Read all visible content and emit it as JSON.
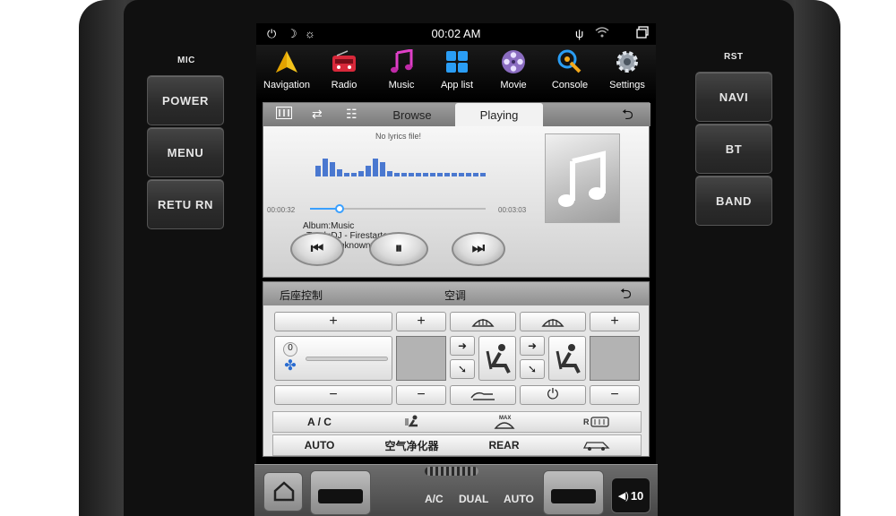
{
  "hardware": {
    "mic_label": "MIC",
    "rst_label": "RST",
    "left_buttons": [
      "POWER",
      "MENU",
      "RETU RN"
    ],
    "right_buttons": [
      "NAVI",
      "BT",
      "BAND"
    ]
  },
  "statusbar": {
    "time": "00:02 AM",
    "icons": [
      "power-icon",
      "night-mode-icon",
      "brightness-icon",
      "usb-icon",
      "wifi-icon",
      "recent-apps-icon"
    ]
  },
  "launcher": {
    "apps": [
      {
        "label": "Navigation",
        "icon": "navigation-icon"
      },
      {
        "label": "Radio",
        "icon": "radio-icon"
      },
      {
        "label": "Music",
        "icon": "music-icon"
      },
      {
        "label": "App list",
        "icon": "app-list-icon"
      },
      {
        "label": "Movie",
        "icon": "movie-icon"
      },
      {
        "label": "Console",
        "icon": "console-icon"
      },
      {
        "label": "Settings",
        "icon": "settings-icon"
      }
    ]
  },
  "player": {
    "tabs": {
      "browse": "Browse",
      "playing": "Playing"
    },
    "lyrics": "No lyrics file!",
    "elapsed": "00:00:32",
    "duration": "00:03:03",
    "progress": 0.17,
    "album": "Album:Music",
    "track": "Track:DJ - Firestarter",
    "artist": "Artist:<unknown>"
  },
  "climate": {
    "left_title": "后座控制",
    "center_title": "空调",
    "fan_level": "0",
    "row1": [
      "A / C",
      "",
      "",
      ""
    ],
    "row2": [
      "AUTO",
      "空气净化器",
      "REAR",
      ""
    ],
    "colors": {
      "accent": "#3aa0ff"
    }
  },
  "panel": {
    "labels": [
      "A/C",
      "DUAL",
      "AUTO"
    ],
    "volume": "10"
  }
}
